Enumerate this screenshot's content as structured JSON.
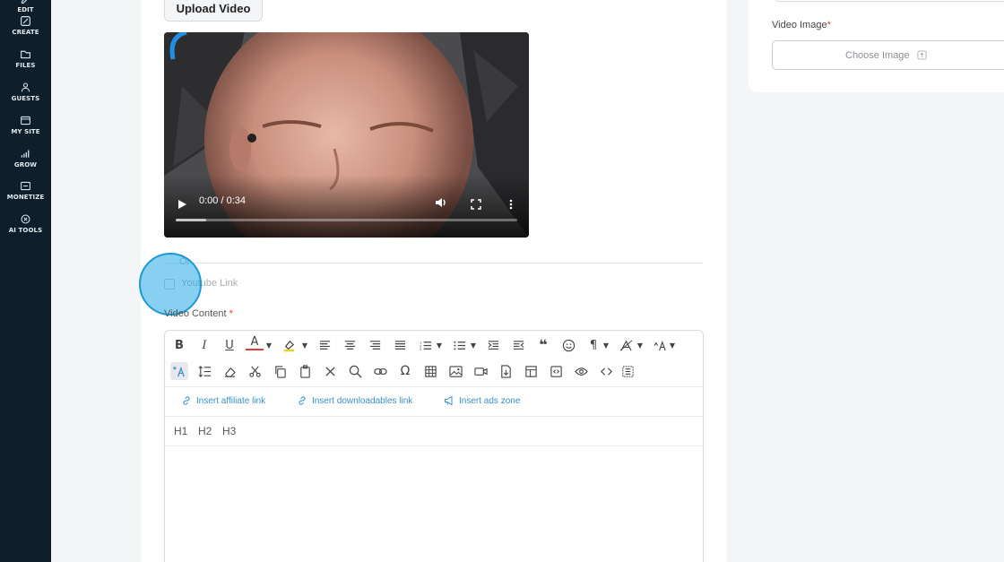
{
  "sidebar": {
    "items": [
      {
        "label": "EDIT",
        "icon": "edit-icon"
      },
      {
        "label": "CREATE",
        "icon": "create-icon"
      },
      {
        "label": "FILES",
        "icon": "files-icon"
      },
      {
        "label": "GUESTS",
        "icon": "guests-icon"
      },
      {
        "label": "MY SITE",
        "icon": "my-site-icon"
      },
      {
        "label": "GROW",
        "icon": "grow-icon"
      },
      {
        "label": "MONETIZE",
        "icon": "monetize-icon"
      },
      {
        "label": "AI TOOLS",
        "icon": "ai-tools-icon"
      }
    ]
  },
  "main": {
    "upload_label": "Upload Video",
    "video": {
      "time": "0:00 / 0:34",
      "progress_fraction": 0.09
    },
    "or_text": "Or",
    "youtube_label": "Youtube Link",
    "content_label": "Video Content",
    "required_mark": "*"
  },
  "editor": {
    "toolbar_row1": [
      "B",
      "I",
      "U",
      "A"
    ],
    "links": {
      "affiliate": "Insert affiliate link",
      "downloadables": "Insert downloadables link",
      "ads": "Insert ads zone"
    },
    "headings": [
      "H1",
      "H2",
      "H3"
    ]
  },
  "right": {
    "image_label": "Video Image",
    "required_mark": "*",
    "choose_label": "Choose Image"
  },
  "colors": {
    "sidebar_bg": "#0e1f2b",
    "link_blue": "#3a8fc7",
    "required_red": "#e23b3b",
    "highlight": "#26aae6"
  }
}
